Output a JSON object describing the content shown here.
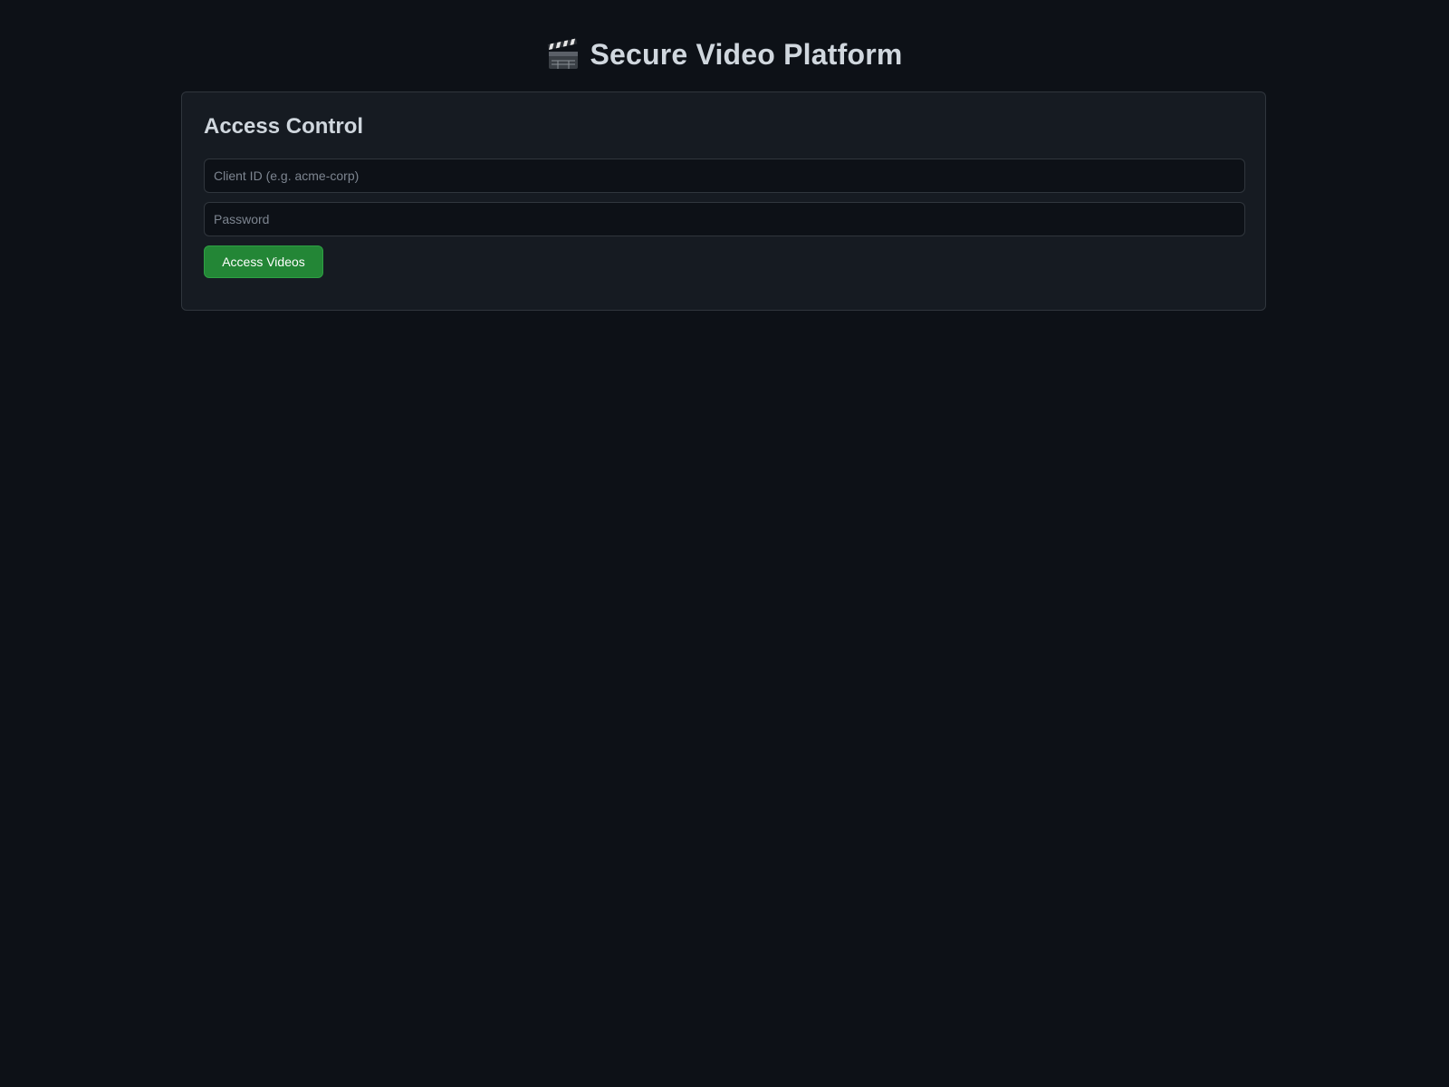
{
  "header": {
    "icon": "clapperboard-icon",
    "title": "Secure Video Platform"
  },
  "access_control": {
    "heading": "Access Control",
    "client_id": {
      "value": "",
      "placeholder": "Client ID (e.g. acme-corp)"
    },
    "password": {
      "value": "",
      "placeholder": "Password"
    },
    "submit_label": "Access Videos"
  },
  "colors": {
    "background": "#0d1117",
    "card": "#161b22",
    "border": "#30363d",
    "accent": "#238636",
    "text": "#d0d7de"
  }
}
